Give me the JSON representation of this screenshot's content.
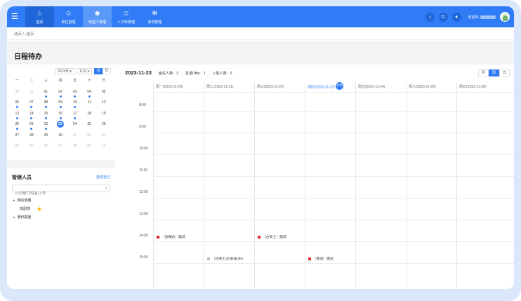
{
  "header": {
    "nav": [
      {
        "label": "首页",
        "icon": "bank-icon"
      },
      {
        "label": "职位管理",
        "icon": "user-gear-icon"
      },
      {
        "label": "候选人管理",
        "icon": "users-icon"
      },
      {
        "label": "人才库管理",
        "icon": "people-icon"
      },
      {
        "label": "系统管理",
        "icon": "gear-icon"
      }
    ],
    "welcome": "欢迎你,"
  },
  "breadcrumb": {
    "home": "首页",
    "sep": "/",
    "current": "首页"
  },
  "page_title": "日程待办",
  "mini_calendar": {
    "year": "2023年",
    "month": "11月",
    "mode_month": "月",
    "mode_year": "年",
    "weekdays": [
      "一",
      "二",
      "三",
      "四",
      "五",
      "六",
      "日"
    ],
    "weeks": [
      [
        {
          "d": "30",
          "dim": true
        },
        {
          "d": "31",
          "dim": true
        },
        {
          "d": "01",
          "dot": true
        },
        {
          "d": "02",
          "dot": true
        },
        {
          "d": "03",
          "dot": true
        },
        {
          "d": "04",
          "dot": true
        },
        {
          "d": "05"
        }
      ],
      [
        {
          "d": "06",
          "dot": true
        },
        {
          "d": "07",
          "dot": true
        },
        {
          "d": "08",
          "dot": true
        },
        {
          "d": "09",
          "dot": true
        },
        {
          "d": "10",
          "dot": true
        },
        {
          "d": "11"
        },
        {
          "d": "12"
        }
      ],
      [
        {
          "d": "13",
          "dot": true
        },
        {
          "d": "14",
          "dot": true
        },
        {
          "d": "15",
          "dot": true
        },
        {
          "d": "16",
          "dot": true
        },
        {
          "d": "17",
          "dot": true
        },
        {
          "d": "18"
        },
        {
          "d": "19"
        }
      ],
      [
        {
          "d": "20",
          "dot": true
        },
        {
          "d": "21",
          "dot": true
        },
        {
          "d": "22",
          "dot": true
        },
        {
          "d": "23",
          "today": true
        },
        {
          "d": "24"
        },
        {
          "d": "25"
        },
        {
          "d": "26"
        }
      ],
      [
        {
          "d": "27"
        },
        {
          "d": "28"
        },
        {
          "d": "29"
        },
        {
          "d": "30"
        },
        {
          "d": "01",
          "dim": true
        },
        {
          "d": "02",
          "dim": true
        },
        {
          "d": "03",
          "dim": true
        }
      ],
      [
        {
          "d": "04",
          "dim": true
        },
        {
          "d": "05",
          "dim": true
        },
        {
          "d": "06",
          "dim": true
        },
        {
          "d": "07",
          "dim": true
        },
        {
          "d": "08",
          "dim": true
        },
        {
          "d": "09",
          "dim": true
        },
        {
          "d": "10",
          "dim": true
        }
      ]
    ]
  },
  "managers": {
    "title": "管理人员",
    "view_self": "查看自己",
    "search_placeholder": "公司/部门/姓名/工号",
    "tree": [
      {
        "label": "我的收藏",
        "level": 0
      },
      {
        "label": "田副部",
        "level": 1,
        "star": true
      },
      {
        "label": "惠科集团",
        "level": 0
      }
    ]
  },
  "schedule": {
    "date": "2023-11-23",
    "interviews": "面试人数：3",
    "offers": "发送Offer：1",
    "onboard": "入职人数：0",
    "views": [
      "月",
      "周",
      "日"
    ],
    "active_view": 1,
    "days": [
      "周一(2023-11-20)",
      "周二(2023-11-21)",
      "周三(2023-11-22)",
      "周四(2023-11-23)",
      "周五(2023-11-24)",
      "周六(2023-11-25)",
      "周日(2023-11-26)"
    ],
    "today_badge": "今日",
    "hours": [
      "8:00",
      "9:00",
      "10:00",
      "11:00",
      "12:00",
      "13:00",
      "14:00",
      "15:00"
    ],
    "events": [
      {
        "day": 0,
        "hour": 6,
        "label": "（金臻达）面试",
        "color": "#e02424"
      },
      {
        "day": 2,
        "hour": 6,
        "label": "（古安士）面试",
        "color": "#e02424"
      },
      {
        "day": 1,
        "hour": 7,
        "label": "（古安士)已发送offer",
        "color": "#bbbbbb"
      },
      {
        "day": 3,
        "hour": 7,
        "label": "（陈适）面试",
        "color": "#e02424"
      }
    ]
  }
}
